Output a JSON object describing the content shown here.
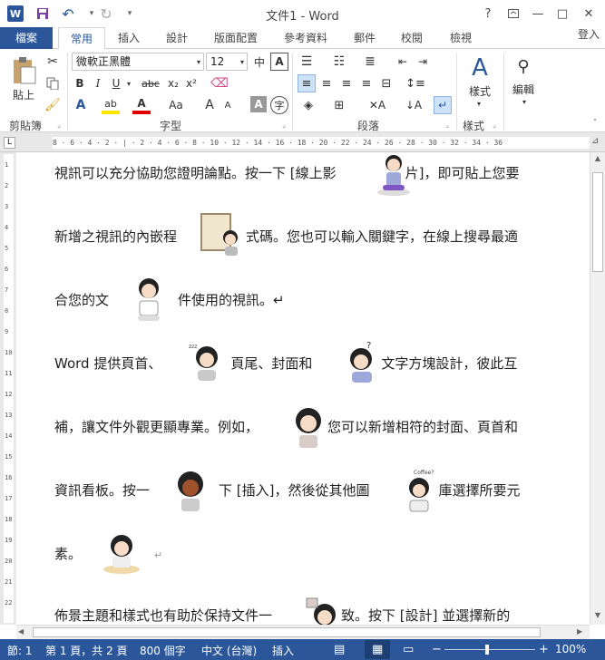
{
  "title_bar": {
    "title": "文件1 - Word",
    "app_icon": "W",
    "help": "?",
    "min": "—",
    "restore": "□",
    "close": "✕"
  },
  "tabs": [
    "檔案",
    "常用",
    "插入",
    "設計",
    "版面配置",
    "參考資料",
    "郵件",
    "校閱",
    "檢視"
  ],
  "sign_in": "登入",
  "ribbon": {
    "clipboard": {
      "label": "剪貼簿",
      "paste": "貼上"
    },
    "font": {
      "label": "字型",
      "font_name": "微軟正黑體",
      "font_size": "12",
      "bold": "B",
      "italic": "I",
      "underline": "U",
      "strike": "abc",
      "subscript": "x₂",
      "superscript": "x²",
      "grow": "A",
      "shrink": "A",
      "phonetic": "中",
      "border": "A",
      "text_effects": "A",
      "highlight": "ab",
      "font_color": "A",
      "case": "Aa",
      "char_shading": "A",
      "enclosed": "字"
    },
    "paragraph": {
      "label": "段落"
    },
    "styles": {
      "label": "樣式",
      "button": "樣式"
    },
    "editing": {
      "button": "編輯"
    }
  },
  "ruler": {
    "h": "8 · 6 · 4 · 2 · | · 2 · 4 · 6 · 8 · 10 · 12 · 14 · 16 · 18 · 20 · 22 · 24 · 26 · 28 · 30 · 32 · 34 · 36",
    "v": [
      "1",
      "2",
      "3",
      "4",
      "5",
      "6",
      "7",
      "8",
      "9",
      "10",
      "11",
      "12",
      "13",
      "14",
      "15",
      "16",
      "17",
      "18",
      "19",
      "20",
      "21",
      "22"
    ]
  },
  "document": {
    "lines": [
      {
        "a": "視訊可以充分協助您證明論點。按一下 [線上影",
        "b": "片]，即可貼上您要"
      },
      {
        "a": "新增之視訊的內嵌程",
        "b": "式碼。您也可以輸入關鍵字，在線上搜尋最適"
      },
      {
        "a": "合您的文",
        "b": "件使用的視訊。↵"
      },
      {
        "a": "Word 提供頁首、",
        "b": "頁尾、封面和",
        "c": "文字方塊設計，彼此互"
      },
      {
        "a": "補，讓文件外觀更顯專業。例如，",
        "b": "您可以新增相符的封面、頁首和"
      },
      {
        "a": "資訊看板。按一",
        "b": "下 [插入]，然後從其他圖",
        "c": "庫選擇所要元"
      },
      {
        "a": "素。",
        "b": "↵"
      },
      {
        "a": "佈景主題和樣式也有助於保持文件一",
        "b": "致。按下 [設計] 並選擇新的"
      }
    ]
  },
  "status_bar": {
    "section": "節: 1",
    "page": "第 1 頁，共 2 頁",
    "words": "800 個字",
    "language": "中文 (台灣)",
    "mode": "插入",
    "zoom": "100%"
  },
  "colors": {
    "accent": "#2b579a"
  }
}
